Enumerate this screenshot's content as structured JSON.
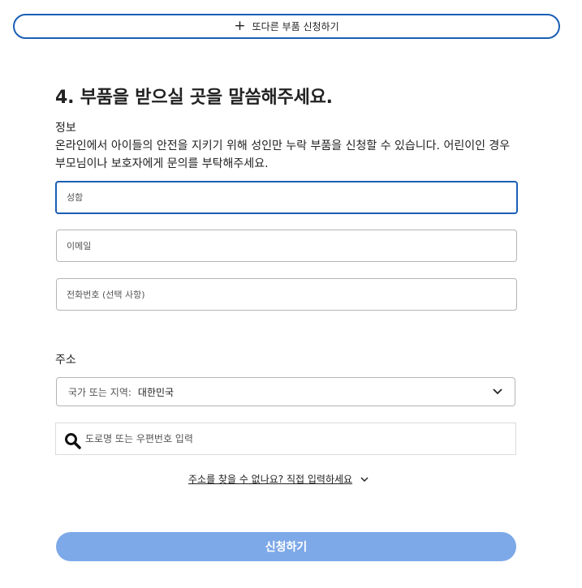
{
  "add_another_button": {
    "icon": "plus-icon",
    "label": "또다른 부품 신청하기"
  },
  "section_title": "4. 부품을 받으실 곳을 말씀해주세요.",
  "info": {
    "label": "정보",
    "description": "온라인에서 아이들의 안전을 지키기 위해 성인만 누락 부품을 신청할 수 있습니다. 어린이인 경우 부모님이나 보호자에게 문의를 부탁해주세요."
  },
  "fields": {
    "name_placeholder": "성함",
    "email_placeholder": "이메일",
    "phone_placeholder": "전화번호 (선택 사항)"
  },
  "address": {
    "label": "주소",
    "country_prefix": "국가 또는 지역:",
    "country_value": "대한민국",
    "search_placeholder": "도로명 또는 우편번호 입력",
    "manual_entry_link": "주소를 찾을 수 없나요? 직접 입력하세요"
  },
  "submit_label": "신청하기",
  "colors": {
    "accent": "#1a5fb4",
    "submit_disabled": "#7ea9e8",
    "border": "#b5b5b5"
  }
}
